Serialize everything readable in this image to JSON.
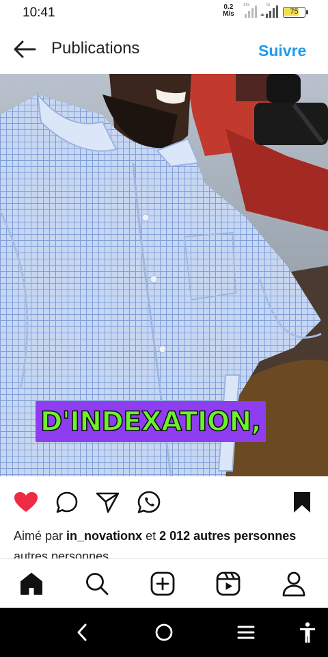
{
  "status_bar": {
    "time": "10:41",
    "net_speed_value": "0.2",
    "net_speed_unit": "M/s",
    "sim1_type": "4G",
    "sim2_type": "G",
    "battery_level": "75",
    "battery_fraction": 0.75
  },
  "header": {
    "title": "Publications",
    "follow_label": "Suivre"
  },
  "post": {
    "caption_overlay": "D'INDEXATION,",
    "likes": {
      "prefix": "Aimé par",
      "user": "in_novationx",
      "connector": "et",
      "count_text": "2 012 autres",
      "count_text_line2": "personnes",
      "suffix": "autres personnes"
    }
  },
  "colors": {
    "accent": "#1d9bf0",
    "like_red": "#ed2b44",
    "caption_bg": "#8e3df0",
    "caption_text": "#6cf22b"
  },
  "icons": {
    "back": "arrow-left-icon",
    "sound": "speaker-on-icon",
    "like": "heart-filled-icon",
    "comment": "comment-bubble-icon",
    "share": "paper-plane-icon",
    "whatsapp": "whatsapp-icon",
    "save": "bookmark-filled-icon",
    "home": "home-icon",
    "search": "search-icon",
    "create": "plus-square-icon",
    "reels": "reels-icon",
    "profile": "person-icon"
  }
}
